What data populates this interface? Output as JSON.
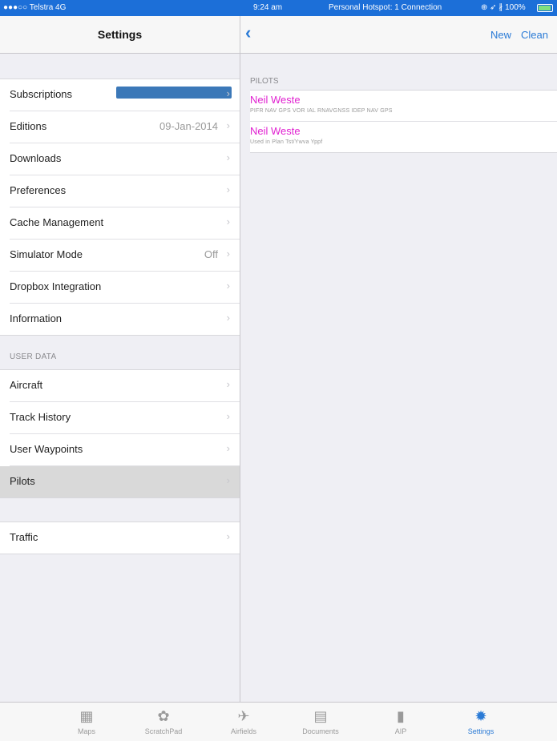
{
  "status_bar": {
    "carrier": "●●●○○ Telstra  4G",
    "time": "9:24 am",
    "hotspot": "Personal Hotspot: 1 Connection",
    "battery": "⊕ ➶ ∦ 100%"
  },
  "left_pane": {
    "title": "Settings",
    "group1": [
      {
        "label": "Subscriptions",
        "detail": ""
      },
      {
        "label": "Editions",
        "detail": "09-Jan-2014"
      },
      {
        "label": "Downloads",
        "detail": ""
      },
      {
        "label": "Preferences",
        "detail": ""
      },
      {
        "label": "Cache Management",
        "detail": ""
      },
      {
        "label": "Simulator Mode",
        "detail": "Off"
      },
      {
        "label": "Dropbox Integration",
        "detail": ""
      },
      {
        "label": "Information",
        "detail": ""
      }
    ],
    "user_data_label": "USER DATA",
    "group2": [
      {
        "label": "Aircraft",
        "detail": ""
      },
      {
        "label": "Track History",
        "detail": ""
      },
      {
        "label": "User Waypoints",
        "detail": ""
      },
      {
        "label": "Pilots",
        "detail": ""
      }
    ],
    "group3": [
      {
        "label": "Traffic",
        "detail": ""
      }
    ],
    "chevron": "›",
    "selected_item": "Pilots"
  },
  "right_pane": {
    "back": "‹",
    "new_button": "New",
    "clean_button": "Clean",
    "section_label": "PILOTS",
    "pilots": [
      {
        "name": "Neil Weste",
        "sub": "PIFR NAV GPS VOR IAL RNAVGNSS IDEP NAV GPS"
      },
      {
        "name": "Neil Weste",
        "sub": "Used in Plan Tst/Ywva Yppf"
      }
    ]
  },
  "tab_bar": {
    "tabs": [
      {
        "label": "Maps",
        "icon": "map-icon",
        "glyph": "▦"
      },
      {
        "label": "ScratchPad",
        "icon": "palette-icon",
        "glyph": "✿"
      },
      {
        "label": "Airfields",
        "icon": "airplane-icon",
        "glyph": "✈"
      },
      {
        "label": "Documents",
        "icon": "box-icon",
        "glyph": "▤"
      },
      {
        "label": "AIP",
        "icon": "book-icon",
        "glyph": "▮"
      },
      {
        "label": "Settings",
        "icon": "gear-icon",
        "glyph": "✹"
      }
    ],
    "active": "Settings"
  },
  "colors": {
    "accent": "#2b7bd6",
    "pilot_name": "#e020d0",
    "status_bar": "#1c6fd8"
  }
}
